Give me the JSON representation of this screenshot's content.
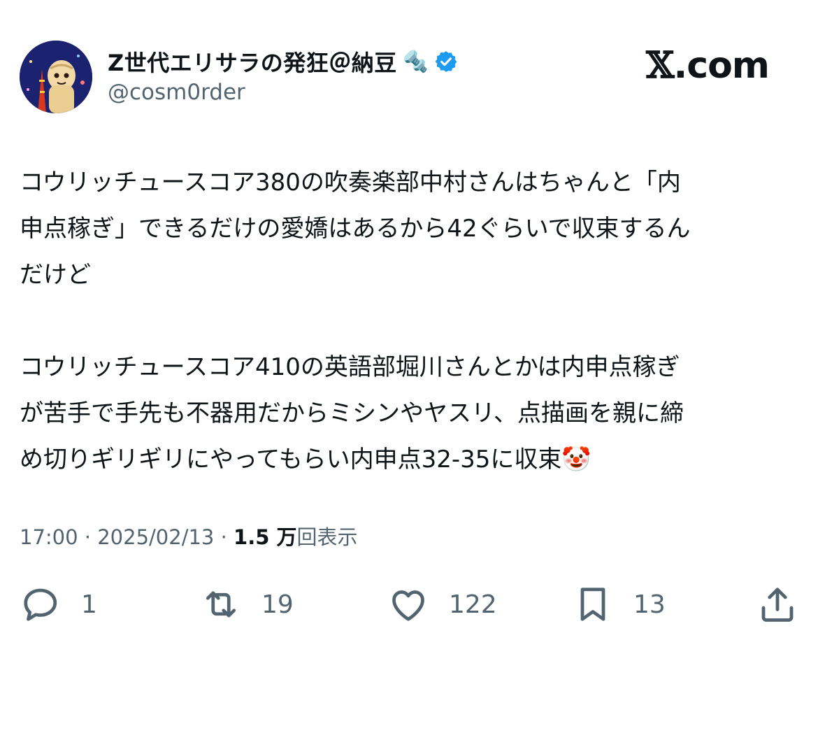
{
  "author": {
    "display_name": "Z世代エリサラの発狂＠納豆",
    "name_emoji": "🔩",
    "verified_icon": "verified-badge-icon",
    "handle": "@cosm0rder"
  },
  "brand": {
    "x_mark": "𝕏",
    "domain": ".com"
  },
  "tweet": {
    "paragraph1": [
      "コウリッチュースコア380の吹奏楽部中村さんはちゃんと「内",
      "申点稼ぎ」できるだけの愛嬌はあるから42ぐらいで収束するん",
      "だけど"
    ],
    "paragraph2": [
      "コウリッチュースコア410の英語部堀川さんとかは内申点稼ぎ",
      "が苦手で手先も不器用だからミシンやヤスリ、点描画を親に締",
      "め切りギリギリにやってもらい内申点32-35に収束🤡"
    ]
  },
  "meta": {
    "time": "17:00",
    "separator": " · ",
    "date": "2025/02/13",
    "views_count": "1.5 万",
    "views_label": "回表示"
  },
  "actions": {
    "reply": {
      "icon": "reply-icon",
      "count": "1"
    },
    "retweet": {
      "icon": "retweet-icon",
      "count": "19"
    },
    "like": {
      "icon": "heart-icon",
      "count": "122"
    },
    "bookmark": {
      "icon": "bookmark-icon",
      "count": "13"
    },
    "share": {
      "icon": "share-icon"
    }
  },
  "colors": {
    "text": "#0f1419",
    "secondary": "#536471",
    "verified": "#1d9bf0"
  }
}
